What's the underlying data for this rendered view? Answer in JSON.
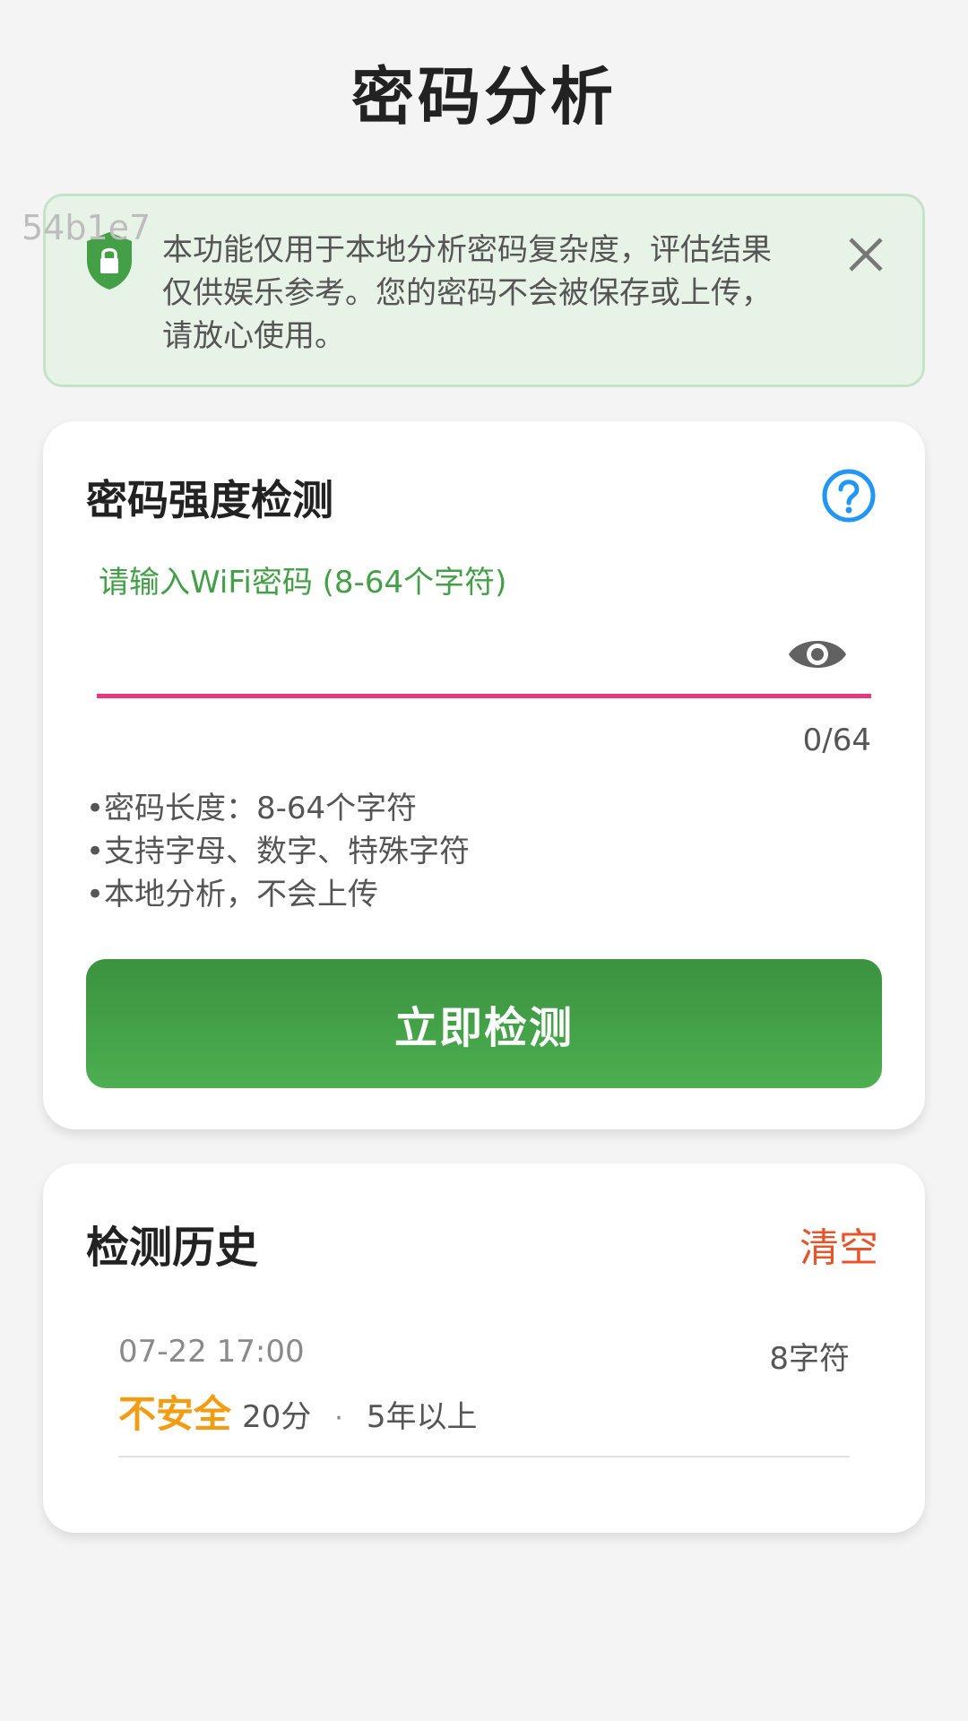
{
  "page": {
    "title": "密码分析"
  },
  "watermark": "54b1e7",
  "notice": {
    "text_line1": "本功能仅用于本地分析密码复杂度，评估结果",
    "text_line2": "仅供娱乐参考。您的密码不会被保存或上传，",
    "text_line3": "请放心使用。",
    "icons": {
      "shield": "shield-lock-icon",
      "close": "close-icon"
    },
    "colors": {
      "background": "#e7f3e7",
      "border": "#c5e4c7",
      "shield": "#43a047"
    }
  },
  "checker": {
    "title": "密码强度检测",
    "help_icon": "question-circle-icon",
    "input": {
      "label": "请输入WiFi密码 (8-64个字符)",
      "value": "",
      "placeholder": ""
    },
    "counter": "0/64",
    "visibility_icon": "eye-icon",
    "tips": [
      "密码长度：8-64个字符",
      "支持字母、数字、特殊字符",
      "本地分析，不会上传"
    ],
    "button_label": "立即检测",
    "colors": {
      "accent": "#43a047",
      "underline": "#e8377c",
      "help": "#2196f3"
    }
  },
  "history": {
    "title": "检测历史",
    "clear_label": "清空",
    "items": [
      {
        "time": "07-22 17:00",
        "length": "8字符",
        "status": "不安全",
        "score": "20分",
        "separator": "·",
        "crack_time": "5年以上"
      }
    ],
    "colors": {
      "clear": "#e8542a",
      "status_unsafe": "#f39c12"
    }
  }
}
